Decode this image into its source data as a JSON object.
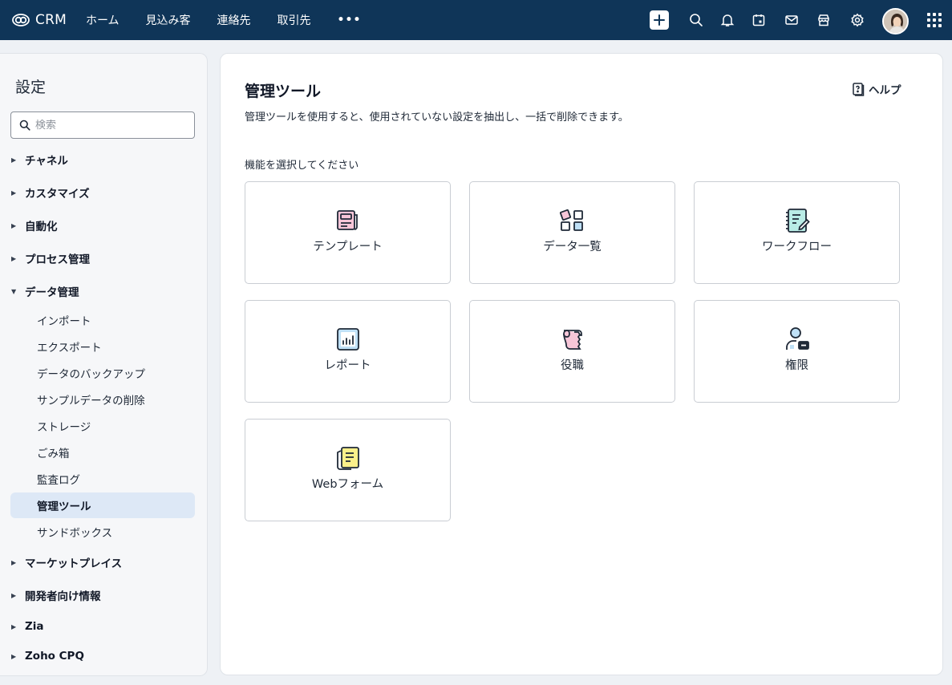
{
  "app": {
    "title": "CRM",
    "logo_icon": "zoho-logo-icon"
  },
  "nav": {
    "items": [
      "ホーム",
      "見込み客",
      "連絡先",
      "取引先"
    ],
    "more": "•••"
  },
  "toolbar_icons": [
    "plus-icon",
    "search-icon",
    "bell-icon",
    "calendar-icon",
    "mail-icon",
    "store-icon",
    "gear-icon",
    "avatar",
    "apps-grid-icon"
  ],
  "sidebar": {
    "title": "設定",
    "search_placeholder": "検索",
    "sections_top": [
      {
        "label": "チャネル",
        "expanded": false
      },
      {
        "label": "カスタマイズ",
        "expanded": false
      },
      {
        "label": "自動化",
        "expanded": false
      },
      {
        "label": "プロセス管理",
        "expanded": false
      },
      {
        "label": "データ管理",
        "expanded": true
      }
    ],
    "data_mgmt_items": [
      "インポート",
      "エクスポート",
      "データのバックアップ",
      "サンプルデータの削除",
      "ストレージ",
      "ごみ箱",
      "監査ログ",
      "管理ツール",
      "サンドボックス"
    ],
    "active_item": "管理ツール",
    "sections_bottom": [
      {
        "label": "マーケットプレイス",
        "expanded": false
      },
      {
        "label": "開発者向け情報",
        "expanded": false
      },
      {
        "label": "Zia",
        "expanded": false
      },
      {
        "label": "Zoho CPQ",
        "expanded": false
      }
    ]
  },
  "main": {
    "title": "管理ツール",
    "help_label": "ヘルプ",
    "description": "管理ツールを使用すると、使用されていない設定を抽出し、一括で削除できます。",
    "select_label": "機能を選択してください",
    "cards": [
      {
        "label": "テンプレート",
        "icon": "template-icon"
      },
      {
        "label": "データ一覧",
        "icon": "data-list-icon"
      },
      {
        "label": "ワークフロー",
        "icon": "workflow-icon"
      },
      {
        "label": "レポート",
        "icon": "report-icon"
      },
      {
        "label": "役職",
        "icon": "role-icon"
      },
      {
        "label": "権限",
        "icon": "permission-icon"
      },
      {
        "label": "Webフォーム",
        "icon": "webform-icon"
      }
    ]
  },
  "colors": {
    "topbar": "#0f3558",
    "active_item_bg": "#dde8f6",
    "accent_pink": "#f7c6d8",
    "accent_blue": "#bfe0f6",
    "accent_teal": "#b9ece6",
    "accent_yellow": "#fbf08a"
  }
}
